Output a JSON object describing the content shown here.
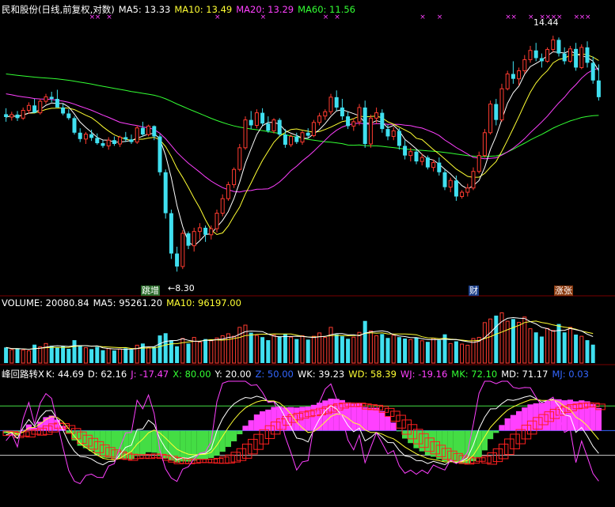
{
  "colors": {
    "bg": "#000000",
    "up": "#ff3b30",
    "down": "#40e0f0",
    "ma5": "#ffffff",
    "ma10": "#ffff33",
    "ma20": "#ff40ff",
    "ma60": "#33ff33",
    "label": "#ffffff",
    "magenta": "#ff40ff",
    "green": "#44dd44",
    "red": "#ff2020",
    "blue": "#3366ff",
    "x_mark": "#ff40ff"
  },
  "price_panel": {
    "title": "民和股份(日线,前复权,对数)",
    "ma5": "MA5: 13.33",
    "ma10": "MA10: 13.49",
    "ma20": "MA20: 13.29",
    "ma60": "MA60: 11.56",
    "high_label": "14.44",
    "low_label": "8.30",
    "tag_left": "跳增",
    "tag_mid": "财",
    "tag_right": "涨张"
  },
  "volume_panel": {
    "label": "VOLUME: 20080.84",
    "ma5": "MA5: 95261.20",
    "ma10": "MA10: 96197.00"
  },
  "indicator_panel": {
    "name": "峰回路转X",
    "k": "K: 44.69",
    "d": "D: 62.16",
    "j": "J: -17.47",
    "x": "X: 80.00",
    "y": "Y: 20.00",
    "z": "Z: 50.00",
    "wk": "WK: 39.23",
    "wd": "WD: 58.39",
    "wj": "WJ: -19.16",
    "mk": "MK: 72.10",
    "md": "MD: 71.17",
    "mj": "MJ: 0.03"
  },
  "chart_data": {
    "type": "candlestick",
    "price": {
      "scale": "log",
      "ylim": [
        7.9,
        15.3
      ],
      "high": 14.44,
      "low": 8.3
    },
    "candles": [
      [
        12.01,
        12.18,
        11.8,
        11.93
      ],
      [
        11.93,
        12.08,
        11.83,
        12.0
      ],
      [
        12.0,
        12.1,
        11.82,
        11.9
      ],
      [
        11.9,
        12.2,
        11.85,
        12.12
      ],
      [
        12.12,
        12.35,
        12.02,
        12.26
      ],
      [
        12.26,
        12.45,
        12.15,
        12.05
      ],
      [
        12.05,
        12.45,
        12.0,
        12.38
      ],
      [
        12.38,
        12.6,
        12.3,
        12.51
      ],
      [
        12.51,
        12.66,
        12.35,
        12.45
      ],
      [
        12.45,
        12.72,
        12.3,
        12.2
      ],
      [
        12.2,
        12.3,
        11.98,
        12.03
      ],
      [
        12.03,
        12.15,
        11.85,
        11.9
      ],
      [
        11.9,
        11.95,
        11.45,
        11.5
      ],
      [
        11.5,
        11.62,
        11.25,
        11.33
      ],
      [
        11.33,
        11.52,
        11.2,
        11.46
      ],
      [
        11.46,
        11.58,
        11.28,
        11.36
      ],
      [
        11.36,
        11.48,
        11.18,
        11.22
      ],
      [
        11.22,
        11.3,
        11.1,
        11.15
      ],
      [
        11.15,
        11.38,
        11.05,
        11.3
      ],
      [
        11.3,
        11.4,
        11.15,
        11.2
      ],
      [
        11.2,
        11.42,
        11.12,
        11.38
      ],
      [
        11.38,
        11.52,
        11.25,
        11.32
      ],
      [
        11.32,
        11.45,
        11.2,
        11.25
      ],
      [
        11.25,
        11.7,
        11.2,
        11.63
      ],
      [
        11.63,
        11.8,
        11.4,
        11.45
      ],
      [
        11.45,
        11.72,
        11.4,
        11.68
      ],
      [
        11.68,
        11.7,
        11.3,
        11.4
      ],
      [
        11.4,
        11.46,
        10.4,
        10.48
      ],
      [
        10.48,
        10.55,
        9.4,
        9.52
      ],
      [
        9.52,
        9.6,
        8.55,
        8.66
      ],
      [
        8.66,
        8.8,
        8.3,
        8.4
      ],
      [
        8.4,
        9.15,
        8.35,
        9.08
      ],
      [
        9.08,
        9.12,
        8.75,
        8.82
      ],
      [
        8.82,
        9.2,
        8.7,
        9.12
      ],
      [
        9.12,
        9.3,
        8.95,
        9.2
      ],
      [
        9.2,
        9.25,
        8.9,
        9.05
      ],
      [
        9.05,
        9.25,
        8.95,
        9.18
      ],
      [
        9.18,
        9.6,
        9.1,
        9.52
      ],
      [
        9.52,
        9.95,
        9.45,
        9.85
      ],
      [
        9.85,
        10.25,
        9.8,
        10.18
      ],
      [
        10.18,
        10.6,
        10.1,
        10.55
      ],
      [
        10.55,
        11.2,
        10.5,
        11.1
      ],
      [
        11.1,
        11.95,
        11.05,
        11.85
      ],
      [
        11.85,
        12.1,
        11.6,
        11.7
      ],
      [
        11.7,
        12.15,
        11.62,
        12.05
      ],
      [
        12.05,
        12.18,
        11.7,
        11.75
      ],
      [
        11.75,
        11.95,
        11.5,
        11.55
      ],
      [
        11.55,
        11.9,
        11.48,
        11.85
      ],
      [
        11.85,
        11.9,
        11.4,
        11.45
      ],
      [
        11.45,
        11.6,
        11.1,
        11.18
      ],
      [
        11.18,
        11.45,
        11.12,
        11.4
      ],
      [
        11.4,
        11.5,
        11.2,
        11.25
      ],
      [
        11.25,
        11.55,
        11.18,
        11.5
      ],
      [
        11.5,
        11.62,
        11.35,
        11.42
      ],
      [
        11.42,
        11.85,
        11.38,
        11.78
      ],
      [
        11.78,
        12.05,
        11.7,
        11.96
      ],
      [
        11.96,
        12.15,
        11.85,
        12.08
      ],
      [
        12.08,
        12.6,
        12.0,
        12.5
      ],
      [
        12.5,
        12.7,
        12.1,
        12.2
      ],
      [
        12.2,
        12.45,
        11.85,
        11.95
      ],
      [
        11.95,
        12.08,
        11.6,
        11.68
      ],
      [
        11.68,
        11.9,
        11.55,
        11.8
      ],
      [
        11.8,
        12.3,
        11.7,
        12.2
      ],
      [
        12.2,
        12.4,
        11.1,
        11.2
      ],
      [
        11.2,
        12.0,
        11.1,
        11.9
      ],
      [
        11.9,
        12.2,
        11.75,
        12.05
      ],
      [
        12.05,
        12.15,
        11.5,
        11.6
      ],
      [
        11.6,
        11.72,
        11.3,
        11.4
      ],
      [
        11.4,
        11.65,
        11.3,
        11.55
      ],
      [
        11.55,
        11.62,
        11.05,
        11.15
      ],
      [
        11.15,
        11.3,
        10.8,
        10.9
      ],
      [
        10.9,
        11.1,
        10.75,
        11.0
      ],
      [
        11.0,
        11.05,
        10.68,
        10.75
      ],
      [
        10.75,
        10.95,
        10.65,
        10.85
      ],
      [
        10.85,
        10.9,
        10.55,
        10.6
      ],
      [
        10.6,
        10.8,
        10.5,
        10.72
      ],
      [
        10.72,
        10.85,
        10.4,
        10.48
      ],
      [
        10.48,
        10.55,
        10.05,
        10.12
      ],
      [
        10.12,
        10.35,
        10.0,
        10.28
      ],
      [
        10.28,
        10.4,
        9.8,
        9.9
      ],
      [
        9.9,
        10.05,
        9.85,
        10.0
      ],
      [
        10.0,
        10.2,
        9.9,
        10.1
      ],
      [
        10.1,
        10.6,
        10.05,
        10.5
      ],
      [
        10.5,
        11.0,
        10.45,
        10.9
      ],
      [
        10.9,
        11.6,
        10.85,
        11.5
      ],
      [
        11.5,
        12.4,
        11.45,
        12.3
      ],
      [
        12.3,
        12.45,
        11.7,
        11.85
      ],
      [
        11.85,
        12.9,
        11.8,
        12.75
      ],
      [
        12.75,
        13.3,
        12.7,
        13.2
      ],
      [
        13.2,
        13.6,
        12.9,
        13.05
      ],
      [
        13.05,
        13.4,
        12.85,
        13.3
      ],
      [
        13.3,
        13.8,
        13.2,
        13.65
      ],
      [
        13.65,
        14.1,
        13.55,
        13.95
      ],
      [
        13.95,
        14.2,
        13.6,
        13.7
      ],
      [
        13.7,
        13.85,
        13.4,
        13.6
      ],
      [
        13.6,
        14.05,
        13.55,
        13.98
      ],
      [
        13.98,
        14.44,
        13.9,
        14.3
      ],
      [
        14.3,
        14.38,
        13.75,
        13.85
      ],
      [
        13.85,
        14.05,
        13.5,
        13.6
      ],
      [
        13.6,
        14.1,
        13.55,
        14.0
      ],
      [
        14.0,
        14.2,
        13.3,
        13.4
      ],
      [
        13.4,
        14.15,
        13.35,
        14.05
      ],
      [
        14.05,
        14.25,
        13.4,
        13.55
      ],
      [
        13.55,
        13.75,
        12.9,
        13.0
      ],
      [
        13.0,
        13.5,
        12.4,
        12.5
      ]
    ],
    "volume": [
      56,
      48,
      52,
      47,
      44,
      66,
      58,
      70,
      62,
      55,
      60,
      51,
      82,
      64,
      55,
      50,
      58,
      46,
      52,
      45,
      50,
      53,
      48,
      64,
      70,
      55,
      58,
      99,
      107,
      82,
      60,
      88,
      70,
      92,
      75,
      86,
      80,
      90,
      98,
      105,
      96,
      128,
      136,
      109,
      99,
      93,
      82,
      100,
      96,
      105,
      93,
      86,
      98,
      84,
      96,
      108,
      92,
      128,
      103,
      96,
      87,
      93,
      110,
      151,
      115,
      98,
      104,
      90,
      100,
      93,
      88,
      84,
      92,
      80,
      76,
      89,
      82,
      103,
      70,
      78,
      68,
      64,
      88,
      92,
      145,
      158,
      170,
      180,
      150,
      158,
      146,
      165,
      123,
      110,
      95,
      124,
      117,
      140,
      110,
      128,
      102,
      96,
      82,
      66
    ],
    "volume_ylim": [
      0,
      190
    ],
    "kdj_ylim": [
      -40,
      110
    ],
    "x_marks": [
      15,
      16,
      18,
      37,
      45,
      56,
      58,
      73,
      76,
      88,
      89,
      92,
      94,
      95,
      96,
      97,
      100,
      101,
      102
    ]
  }
}
